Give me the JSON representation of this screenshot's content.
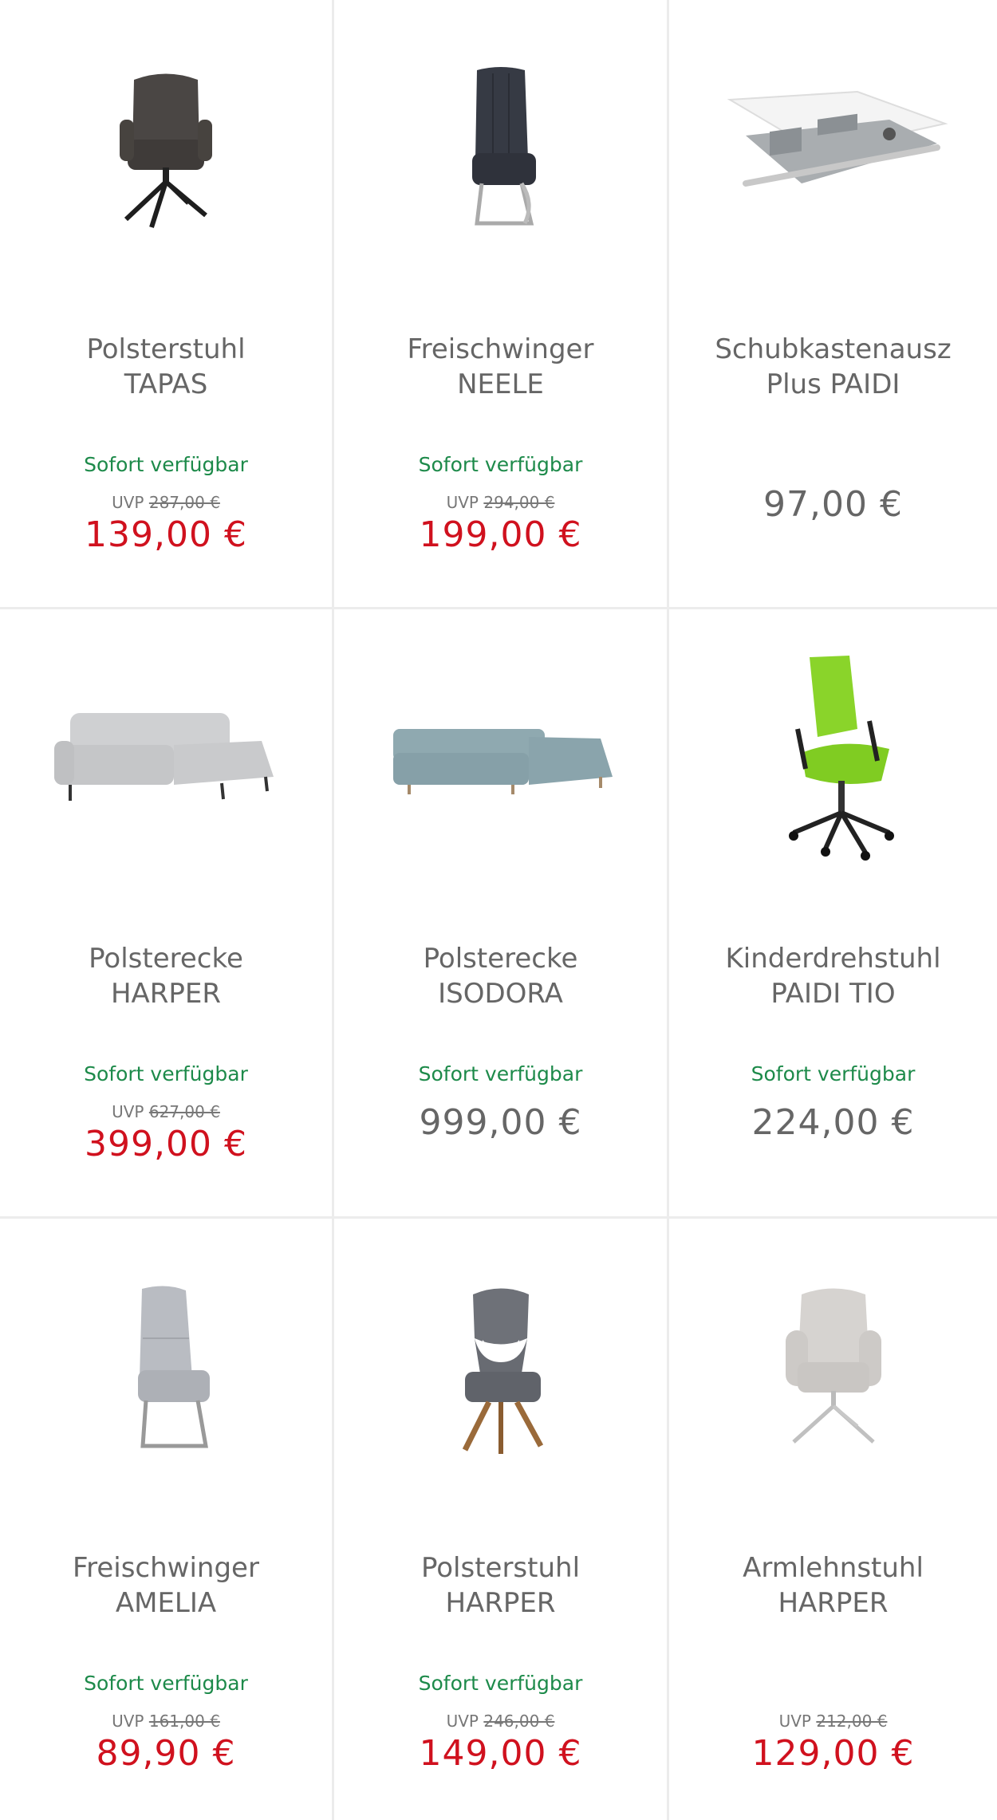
{
  "colors": {
    "availability": "#1d8a4a",
    "sale_price": "#d0111e",
    "regular_price": "#666666",
    "divider": "#ececec"
  },
  "products": [
    {
      "name_line1": "Polsterstuhl",
      "name_line2": "TAPAS",
      "availability": "Sofort verfügbar",
      "uvp_label": "UVP",
      "uvp_value": "287,00 €",
      "price": "139,00 €",
      "image_icon": "armchair-swivel-dark-icon"
    },
    {
      "name_line1": "Freischwinger",
      "name_line2": "NEELE",
      "availability": "Sofort verfügbar",
      "uvp_label": "UVP",
      "uvp_value": "294,00 €",
      "price": "199,00 €",
      "image_icon": "cantilever-chair-dark-icon"
    },
    {
      "name_line1": "Schubkastenausz",
      "name_line2": "Plus PAIDI",
      "price": "97,00 €",
      "image_icon": "drawer-insert-icon"
    },
    {
      "name_line1": "Polsterecke",
      "name_line2": "HARPER",
      "availability": "Sofort verfügbar",
      "uvp_label": "UVP",
      "uvp_value": "627,00 €",
      "price": "399,00 €",
      "image_icon": "corner-sofa-light-grey-icon"
    },
    {
      "name_line1": "Polsterecke",
      "name_line2": "ISODORA",
      "availability": "Sofort verfügbar",
      "price": "999,00 €",
      "image_icon": "corner-sofa-blue-icon"
    },
    {
      "name_line1": "Kinderdrehstuhl",
      "name_line2": "PAIDI TIO",
      "availability": "Sofort verfügbar",
      "price": "224,00 €",
      "image_icon": "office-chair-green-icon"
    },
    {
      "name_line1": "Freischwinger",
      "name_line2": "AMELIA",
      "availability": "Sofort verfügbar",
      "uvp_label": "UVP",
      "uvp_value": "161,00 €",
      "price": "89,90 €",
      "image_icon": "cantilever-chair-light-icon"
    },
    {
      "name_line1": "Polsterstuhl",
      "name_line2": "HARPER",
      "availability": "Sofort verfügbar",
      "uvp_label": "UVP",
      "uvp_value": "246,00 €",
      "price": "149,00 €",
      "image_icon": "chair-wooden-legs-icon"
    },
    {
      "name_line1": "Armlehnstuhl",
      "name_line2": "HARPER",
      "uvp_label": "UVP",
      "uvp_value": "212,00 €",
      "price": "129,00 €",
      "image_icon": "armchair-swivel-light-icon"
    }
  ]
}
